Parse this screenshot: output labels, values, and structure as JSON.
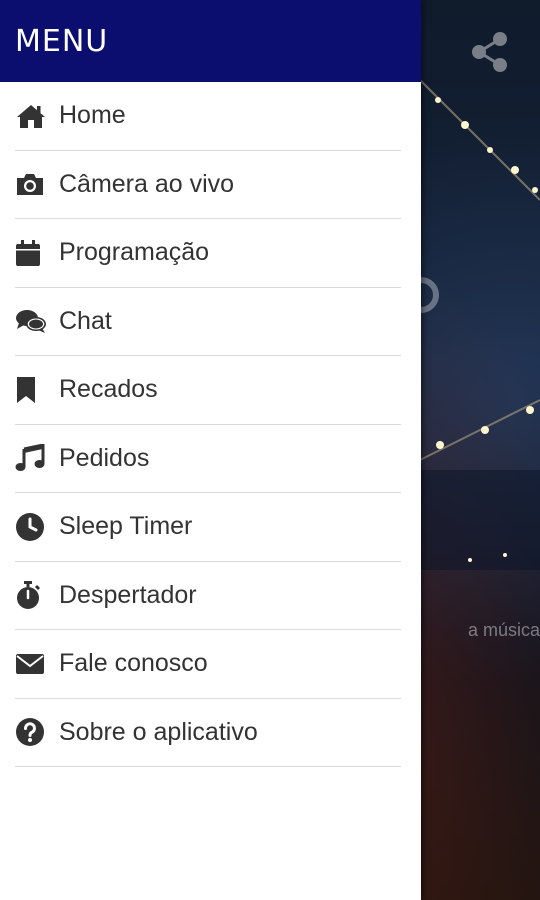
{
  "drawer": {
    "title": "MENU",
    "header_color": "#0b0e6e"
  },
  "menu": {
    "items": [
      {
        "label": "Home",
        "icon": "home-icon"
      },
      {
        "label": "Câmera ao vivo",
        "icon": "camera-icon"
      },
      {
        "label": "Programação",
        "icon": "calendar-icon"
      },
      {
        "label": "Chat",
        "icon": "chat-icon"
      },
      {
        "label": "Recados",
        "icon": "bookmark-icon"
      },
      {
        "label": "Pedidos",
        "icon": "music-note-icon"
      },
      {
        "label": "Sleep Timer",
        "icon": "clock-icon"
      },
      {
        "label": "Despertador",
        "icon": "stopwatch-icon"
      },
      {
        "label": "Fale conosco",
        "icon": "envelope-icon"
      },
      {
        "label": "Sobre o aplicativo",
        "icon": "question-circle-icon"
      }
    ]
  },
  "background": {
    "caption": "a música",
    "share_icon": "share-icon"
  }
}
